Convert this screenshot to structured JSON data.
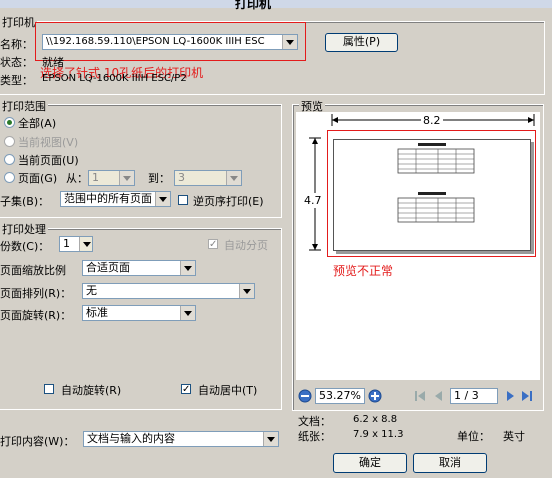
{
  "window": {
    "title": "打印机"
  },
  "printer": {
    "group_title": "打印机",
    "name_label": "名称：",
    "name_value": "\\\\192.168.59.110\\EPSON LQ-1600K IIIH ESC",
    "properties_button": "属性(P)",
    "status_label": "状态：",
    "status_value": "就绪",
    "type_label": "类型：",
    "type_value": "EPSON LQ-1600K IIIH ESC/P2",
    "annotation": "选择了针式   10孔纸后的打印机"
  },
  "range": {
    "group_title": "打印范围",
    "all": "全部(A)",
    "current_view": "当前视图(V)",
    "current_page": "当前页面(U)",
    "pages": "页面(G)",
    "from_label": "从：",
    "from_value": "1",
    "to_label": "到：",
    "to_value": "3",
    "subset_label": "子集(B)：",
    "subset_value": "范围中的所有页面",
    "reverse_label": "逆页序打印(E)"
  },
  "handling": {
    "group_title": "打印处理",
    "copies_label": "份数(C)：",
    "copies_value": "1",
    "collate_label": "自动分页",
    "scale_label": "页面缩放比例",
    "scale_value": "合适页面",
    "arrange_label": "页面排列(R)：",
    "arrange_value": "无",
    "rotate_label": "页面旋转(R)：",
    "rotate_value": "标准",
    "auto_rotate": "自动旋转(R)",
    "auto_center": "自动居中(T)"
  },
  "preview": {
    "group_title": "预览",
    "width_dim": "8.2",
    "height_dim": "4.7",
    "annotation": "预览不正常",
    "zoom": "53.27%",
    "page_indicator": "1 / 3",
    "doc_label": "文档：",
    "doc_value": "6.2 x 8.8",
    "paper_label": "纸张：",
    "paper_value": "7.9 x 11.3",
    "unit_label": "单位：",
    "unit_value": "英寸"
  },
  "content": {
    "label": "打印内容(W)：",
    "value": "文档与输入的内容"
  },
  "buttons": {
    "ok": "确定",
    "cancel": "取消"
  }
}
